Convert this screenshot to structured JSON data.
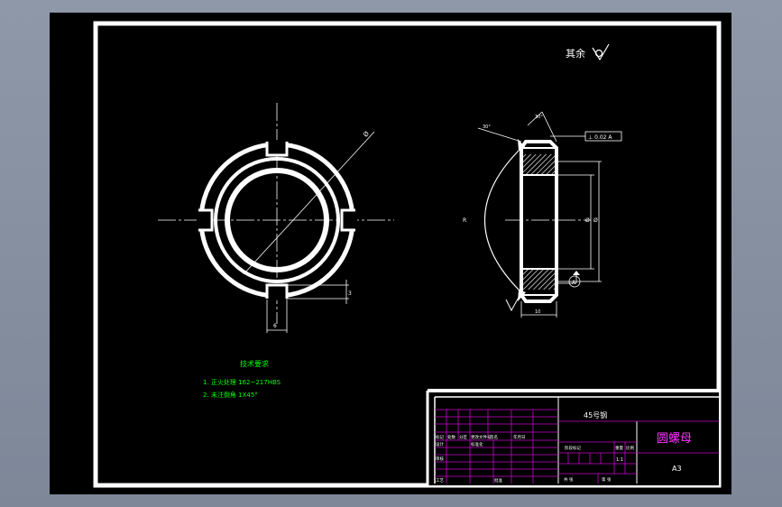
{
  "colors": {
    "background": "#000000",
    "frame": "#ffffff",
    "tech_text": "#00ff00",
    "title_lines": "#cc00cc",
    "title_text": "#ff33ff",
    "dim": "#ffffff"
  },
  "roughness_note": {
    "label": "其余"
  },
  "dimensions": {
    "diameter": "Ø",
    "slot_width": "6",
    "slot_depth": "3",
    "chamfer_top": "30°",
    "chamfer_left": "30°",
    "side_ref": "A",
    "profile_arc": "R",
    "inner_dia": "Ø",
    "outer_dia": "Ø",
    "thickness": "10",
    "tolerance_box": "⊥ 0.02 A"
  },
  "tech_requirements": {
    "title": "技术要求",
    "items": [
      "1. 正火处理 162~217HBS",
      "2. 未注倒角 1X45°"
    ]
  },
  "title_block": {
    "material": "45号钢",
    "part_name": "圆螺母",
    "sheet_size": "A3",
    "scale_value": "1:1",
    "cells": [
      "标记",
      "处数",
      "分区",
      "更改文件号",
      "签名",
      "年月日",
      "设计",
      "标准化",
      "审核",
      "工艺",
      "批准",
      "阶段标记",
      "重量",
      "比例",
      "共 张",
      "第 张"
    ]
  }
}
